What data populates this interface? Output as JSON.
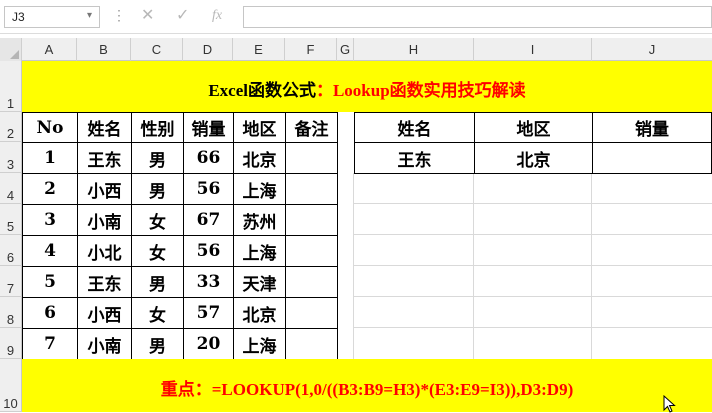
{
  "formula_bar": {
    "name_box": "J3",
    "name_box_arrow": "▾",
    "dots": "⋮",
    "cancel": "✕",
    "enter": "✓",
    "fx": "fx",
    "input_value": ""
  },
  "columns": [
    "A",
    "B",
    "C",
    "D",
    "E",
    "F",
    "G",
    "H",
    "I",
    "J"
  ],
  "rows": [
    "1",
    "2",
    "3",
    "4",
    "5",
    "6",
    "7",
    "8",
    "9",
    "10"
  ],
  "title": {
    "part1": "Excel函数公式",
    "part2": "：Lookup函数实用技巧解读"
  },
  "left_table": {
    "headers": [
      "No",
      "姓名",
      "性别",
      "销量",
      "地区",
      "备注"
    ],
    "rows": [
      [
        "1",
        "王东",
        "男",
        "66",
        "北京",
        ""
      ],
      [
        "2",
        "小西",
        "男",
        "56",
        "上海",
        ""
      ],
      [
        "3",
        "小南",
        "女",
        "67",
        "苏州",
        ""
      ],
      [
        "4",
        "小北",
        "女",
        "56",
        "上海",
        ""
      ],
      [
        "5",
        "王东",
        "男",
        "33",
        "天津",
        ""
      ],
      [
        "6",
        "小西",
        "女",
        "57",
        "北京",
        ""
      ],
      [
        "7",
        "小南",
        "男",
        "20",
        "上海",
        ""
      ]
    ]
  },
  "right_table": {
    "headers": [
      "姓名",
      "地区",
      "销量"
    ],
    "row": [
      "王东",
      "北京",
      ""
    ]
  },
  "note": {
    "label": "重点：",
    "formula": "=LOOKUP(1,0/((B3:B9=H3)*(E3:E9=I3)),D3:D9)"
  },
  "colors": {
    "band": "#ffff00",
    "title_dark": "#000000",
    "accent_red": "#ff0000"
  }
}
